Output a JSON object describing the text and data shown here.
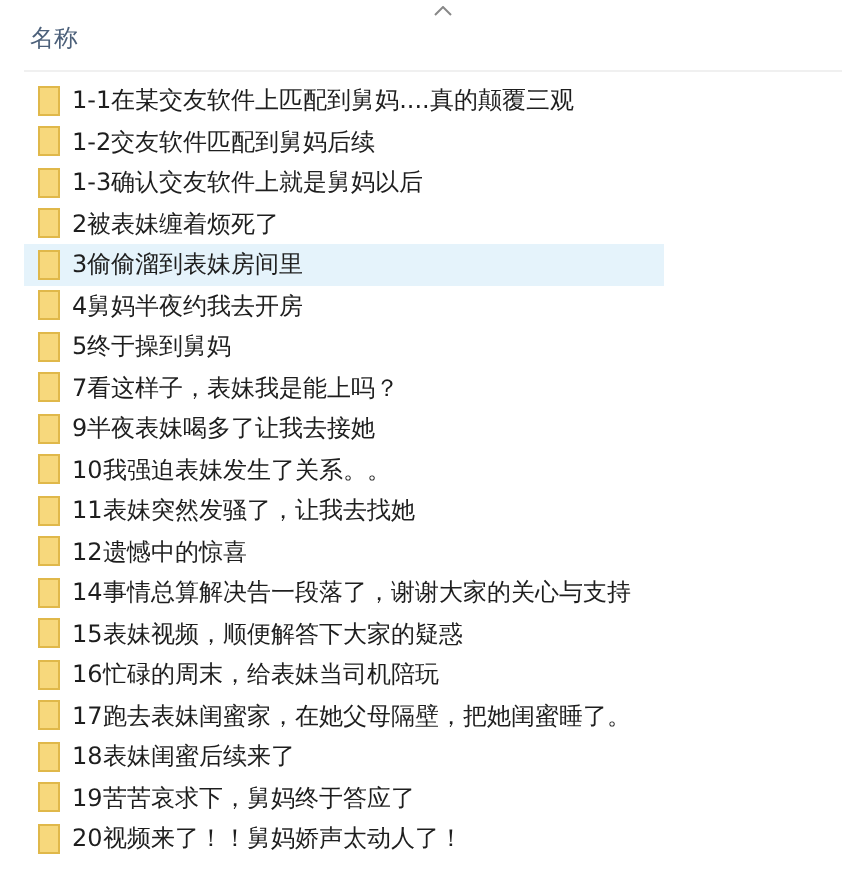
{
  "header": {
    "label": "名称",
    "sort_ascending": true
  },
  "items": [
    {
      "name": "1-1在某交友软件上匹配到舅妈....真的颠覆三观",
      "selected": false
    },
    {
      "name": "1-2交友软件匹配到舅妈后续",
      "selected": false
    },
    {
      "name": "1-3确认交友软件上就是舅妈以后",
      "selected": false
    },
    {
      "name": "2被表妹缠着烦死了",
      "selected": false
    },
    {
      "name": "3偷偷溜到表妹房间里",
      "selected": true
    },
    {
      "name": "4舅妈半夜约我去开房",
      "selected": false
    },
    {
      "name": "5终于操到舅妈",
      "selected": false
    },
    {
      "name": "7看这样子，表妹我是能上吗？",
      "selected": false
    },
    {
      "name": "9半夜表妹喝多了让我去接她",
      "selected": false
    },
    {
      "name": "10我强迫表妹发生了关系。。",
      "selected": false
    },
    {
      "name": "11表妹突然发骚了，让我去找她",
      "selected": false
    },
    {
      "name": "12遗憾中的惊喜",
      "selected": false
    },
    {
      "name": "14事情总算解决告一段落了，谢谢大家的关心与支持",
      "selected": false
    },
    {
      "name": "15表妹视频，顺便解答下大家的疑惑",
      "selected": false
    },
    {
      "name": "16忙碌的周末，给表妹当司机陪玩",
      "selected": false
    },
    {
      "name": "17跑去表妹闺蜜家，在她父母隔壁，把她闺蜜睡了。",
      "selected": false
    },
    {
      "name": "18表妹闺蜜后续来了",
      "selected": false
    },
    {
      "name": "19苦苦哀求下，舅妈终于答应了",
      "selected": false
    },
    {
      "name": "20视频来了！！舅妈娇声太动人了！",
      "selected": false
    }
  ]
}
